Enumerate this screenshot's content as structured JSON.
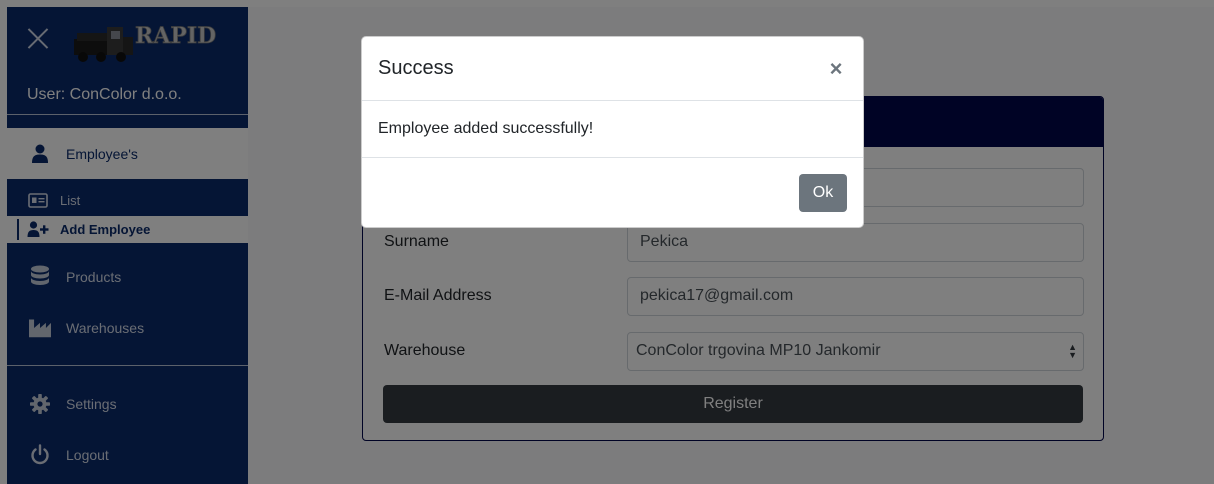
{
  "sidebar": {
    "logo_text": "RAPID",
    "user_label": "User: ConColor d.o.o.",
    "nav": {
      "employees": "Employee's",
      "products": "Products",
      "warehouses": "Warehouses",
      "settings": "Settings",
      "logout": "Logout"
    },
    "sub": {
      "list": "List",
      "add_employee": "Add Employee"
    },
    "icons": {
      "close": "close-icon",
      "employees": "user-icon",
      "list": "id-card-icon",
      "add_employee": "user-plus-icon",
      "products": "database-icon",
      "warehouses": "industry-icon",
      "settings": "gear-icon",
      "logout": "power-icon"
    }
  },
  "form": {
    "fields": [
      {
        "label": "",
        "value": ""
      },
      {
        "label": "Surname",
        "value": "Pekica"
      },
      {
        "label": "E-Mail Address",
        "value": "pekica17@gmail.com"
      },
      {
        "label": "Warehouse",
        "value": "ConColor trgovina MP10 Jankomir"
      }
    ],
    "register_label": "Register"
  },
  "modal": {
    "title": "Success",
    "close_glyph": "×",
    "message": "Employee added successfully!",
    "ok_label": "Ok"
  },
  "colors": {
    "sidebar_bg": "#0a2a6b",
    "card_header": "#00064a",
    "register_btn": "#343a40",
    "ok_btn": "#6c757d"
  }
}
